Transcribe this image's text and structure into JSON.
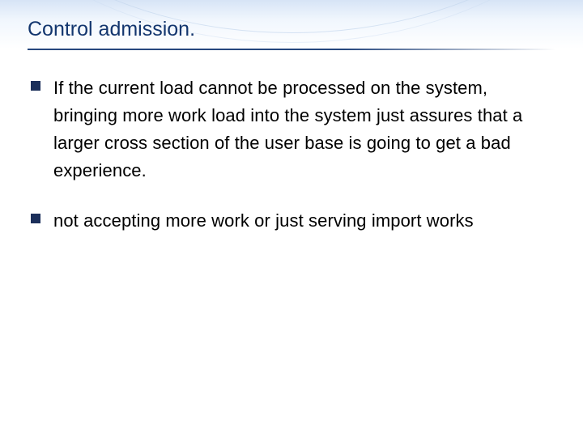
{
  "slide": {
    "title": "Control admission.",
    "bullets": [
      "If the current load cannot be processed on the system, bringing more work load into the system just assures that a larger cross section of the user base is going to get a bad experience.",
      "not accepting more work or just serving import works"
    ]
  }
}
